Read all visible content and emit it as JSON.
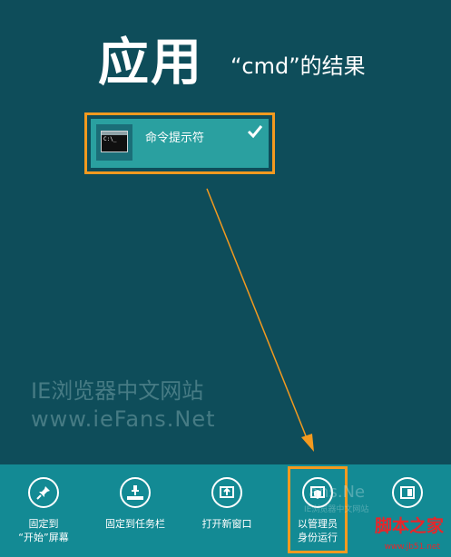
{
  "header": {
    "title": "应用",
    "subtitle": "“cmd”的结果"
  },
  "result": {
    "label": "命令提示符",
    "icon_text": "C:\\_"
  },
  "watermark": {
    "line1": "IE浏览器中文网站",
    "line2": "www.ieFans.Net",
    "appbar_text": "ans.Ne",
    "appbar_small": "IE浏览器中文网站",
    "site_name": "脚本之家",
    "site_url": "www.jb51.net"
  },
  "app_bar": {
    "commands": [
      {
        "label": "固定到\n“开始”屏幕",
        "icon": "pin-icon"
      },
      {
        "label": "固定到任务栏",
        "icon": "taskbar-pin-icon"
      },
      {
        "label": "打开新窗口",
        "icon": "new-window-icon"
      },
      {
        "label": "以管理员\n身份运行",
        "icon": "admin-shield-icon"
      },
      {
        "label": "",
        "icon": "file-location-icon"
      }
    ]
  },
  "colors": {
    "background": "#0e4d5a",
    "tile": "#2aa0a0",
    "app_bar": "#138a94",
    "highlight": "#f39a1f",
    "site_watermark": "#e8262a"
  }
}
